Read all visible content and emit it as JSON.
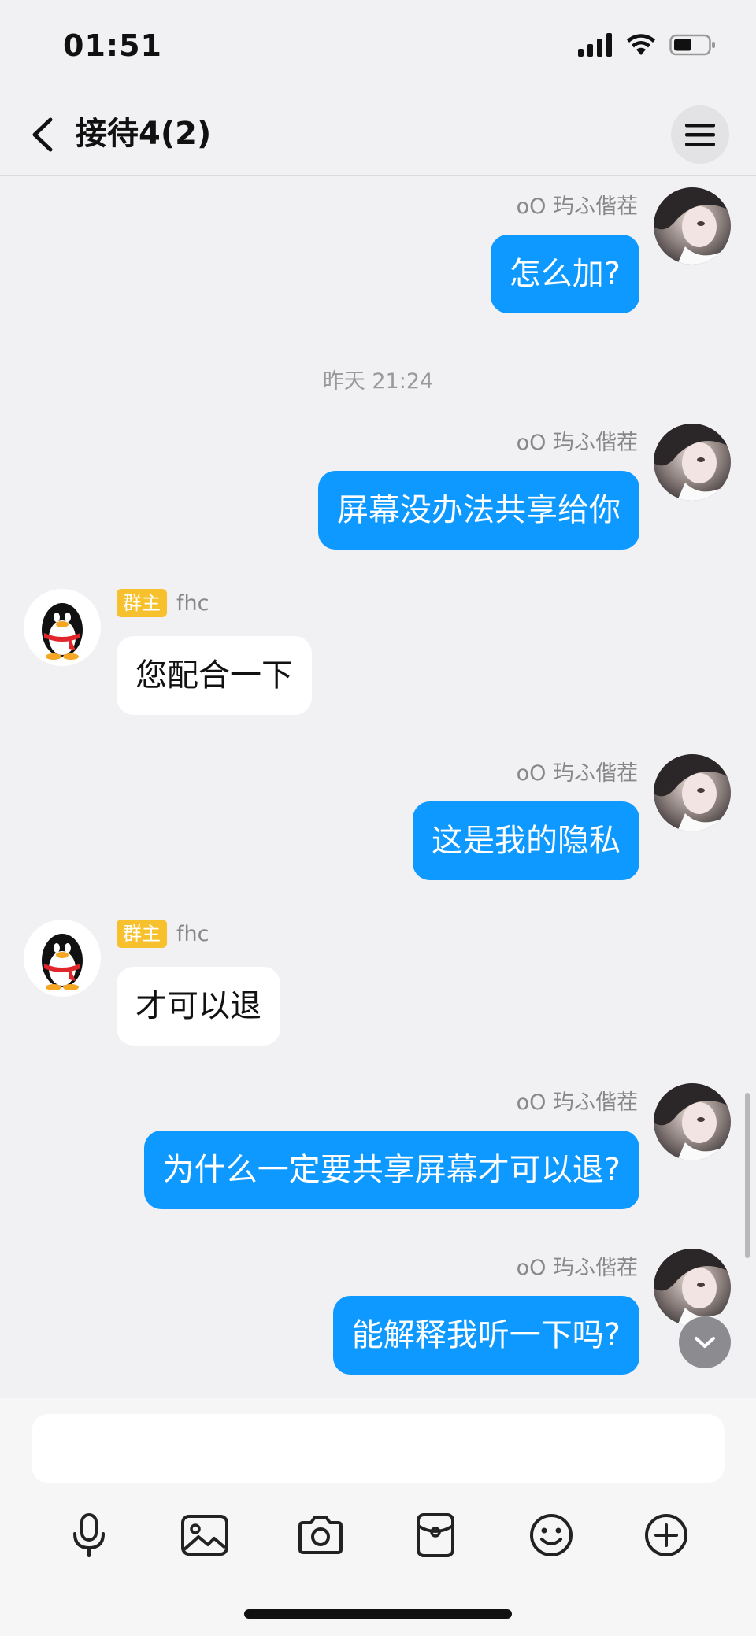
{
  "status": {
    "time": "01:51"
  },
  "header": {
    "title": "接待4(2)"
  },
  "messages": [
    {
      "sender": "oO 玙ふ偕茬",
      "text": "怎么加?"
    },
    {
      "timestamp": "昨天 21:24"
    },
    {
      "sender": "oO 玙ふ偕茬",
      "text": "屏幕没办法共享给你"
    },
    {
      "badge": "群主",
      "sender": "fhc",
      "text": "您配合一下"
    },
    {
      "sender": "oO 玙ふ偕茬",
      "text": "这是我的隐私"
    },
    {
      "badge": "群主",
      "sender": "fhc",
      "text": "才可以退"
    },
    {
      "sender": "oO 玙ふ偕茬",
      "text": "为什么一定要共享屏幕才可以退?"
    },
    {
      "sender": "oO 玙ふ偕茬",
      "text": "能解释我听一下吗?"
    }
  ],
  "composer": {
    "placeholder": ""
  },
  "toolbar": [
    "microphone-icon",
    "image-icon",
    "camera-icon",
    "red-packet-icon",
    "emoji-icon",
    "plus-icon"
  ],
  "colors": {
    "outgoing_bubble": "#0d99ff",
    "incoming_bubble": "#ffffff",
    "owner_badge": "#f7c12e"
  }
}
